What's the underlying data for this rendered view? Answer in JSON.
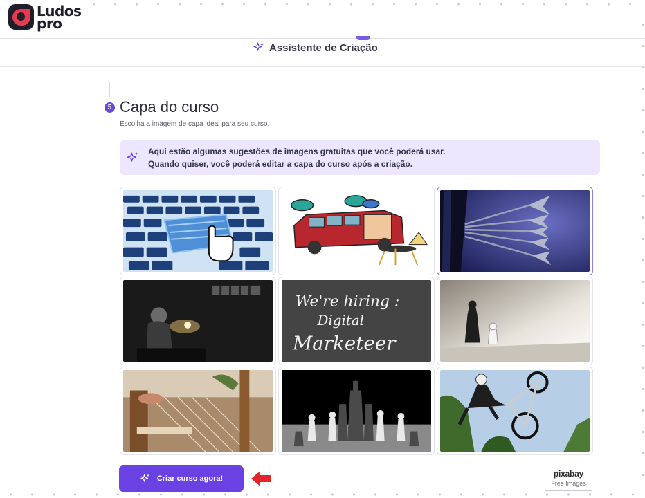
{
  "header": {
    "logo_line1": "Ludos",
    "logo_line2": "pro",
    "assistant_tab_label": "Assistente de Criação"
  },
  "section": {
    "step_number": "5",
    "title": "Capa do curso",
    "subtitle": "Escolha a imagem de capa ideal para seu curso."
  },
  "info_box": {
    "line1": "Aqui estão algumas sugestões de imagens gratuitas que você poderá usar.",
    "line2": "Quando quiser, você poderá editar a capa do curso após a criação."
  },
  "images": [
    {
      "name": "keyboard-cart",
      "selected": false
    },
    {
      "name": "vintage-van",
      "selected": false
    },
    {
      "name": "darts-target",
      "selected": true
    },
    {
      "name": "dark-workshop",
      "selected": false
    },
    {
      "name": "chalkboard-hiring",
      "selected": false
    },
    {
      "name": "chess-pieces-pair",
      "selected": false
    },
    {
      "name": "weaving-loom",
      "selected": false
    },
    {
      "name": "chess-board-bw",
      "selected": false
    },
    {
      "name": "bmx-rider",
      "selected": false
    }
  ],
  "chalkboard_text": {
    "line1": "We're hiring :",
    "line2": "Digital",
    "line3": "Marketeer"
  },
  "footer": {
    "create_button_label": "Criar curso agora!",
    "pixabay_brand": "pixabay",
    "pixabay_sub": "Free Images"
  },
  "colors": {
    "accent": "#6a42e4",
    "info_bg": "#ece7ff",
    "arrow": "#e3242b"
  }
}
